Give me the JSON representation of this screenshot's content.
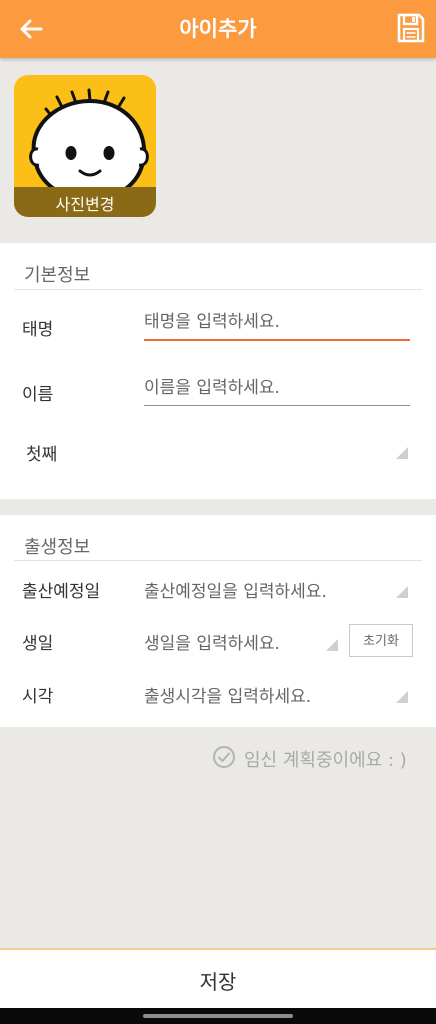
{
  "header": {
    "title": "아이추가",
    "back_icon": "back-arrow-icon",
    "save_icon": "floppy-disk-icon",
    "background": "#fb9a3e"
  },
  "photo": {
    "change_label": "사진변경",
    "placeholder_icon": "baby-face-icon",
    "background": "#fbbf17"
  },
  "basic_info": {
    "title": "기본정보",
    "fields": [
      {
        "label": "태명",
        "placeholder": "태명을 입력하세요."
      },
      {
        "label": "이름",
        "placeholder": "이름을 입력하세요."
      }
    ],
    "birth_order": {
      "selected": "첫째"
    }
  },
  "birth_info": {
    "title": "출생정보",
    "fields": [
      {
        "label": "출산예정일",
        "placeholder": "출산예정일을 입력하세요."
      },
      {
        "label": "생일",
        "placeholder": "생일을 입력하세요."
      },
      {
        "label": "시각",
        "placeholder": "출생시각을 입력하세요."
      }
    ],
    "reset_label": "초기화"
  },
  "planning": {
    "label": "임신 계획중이에요 : )",
    "icon": "check-circle-icon"
  },
  "footer": {
    "save_label": "저장",
    "accent": "#f3c98e"
  }
}
